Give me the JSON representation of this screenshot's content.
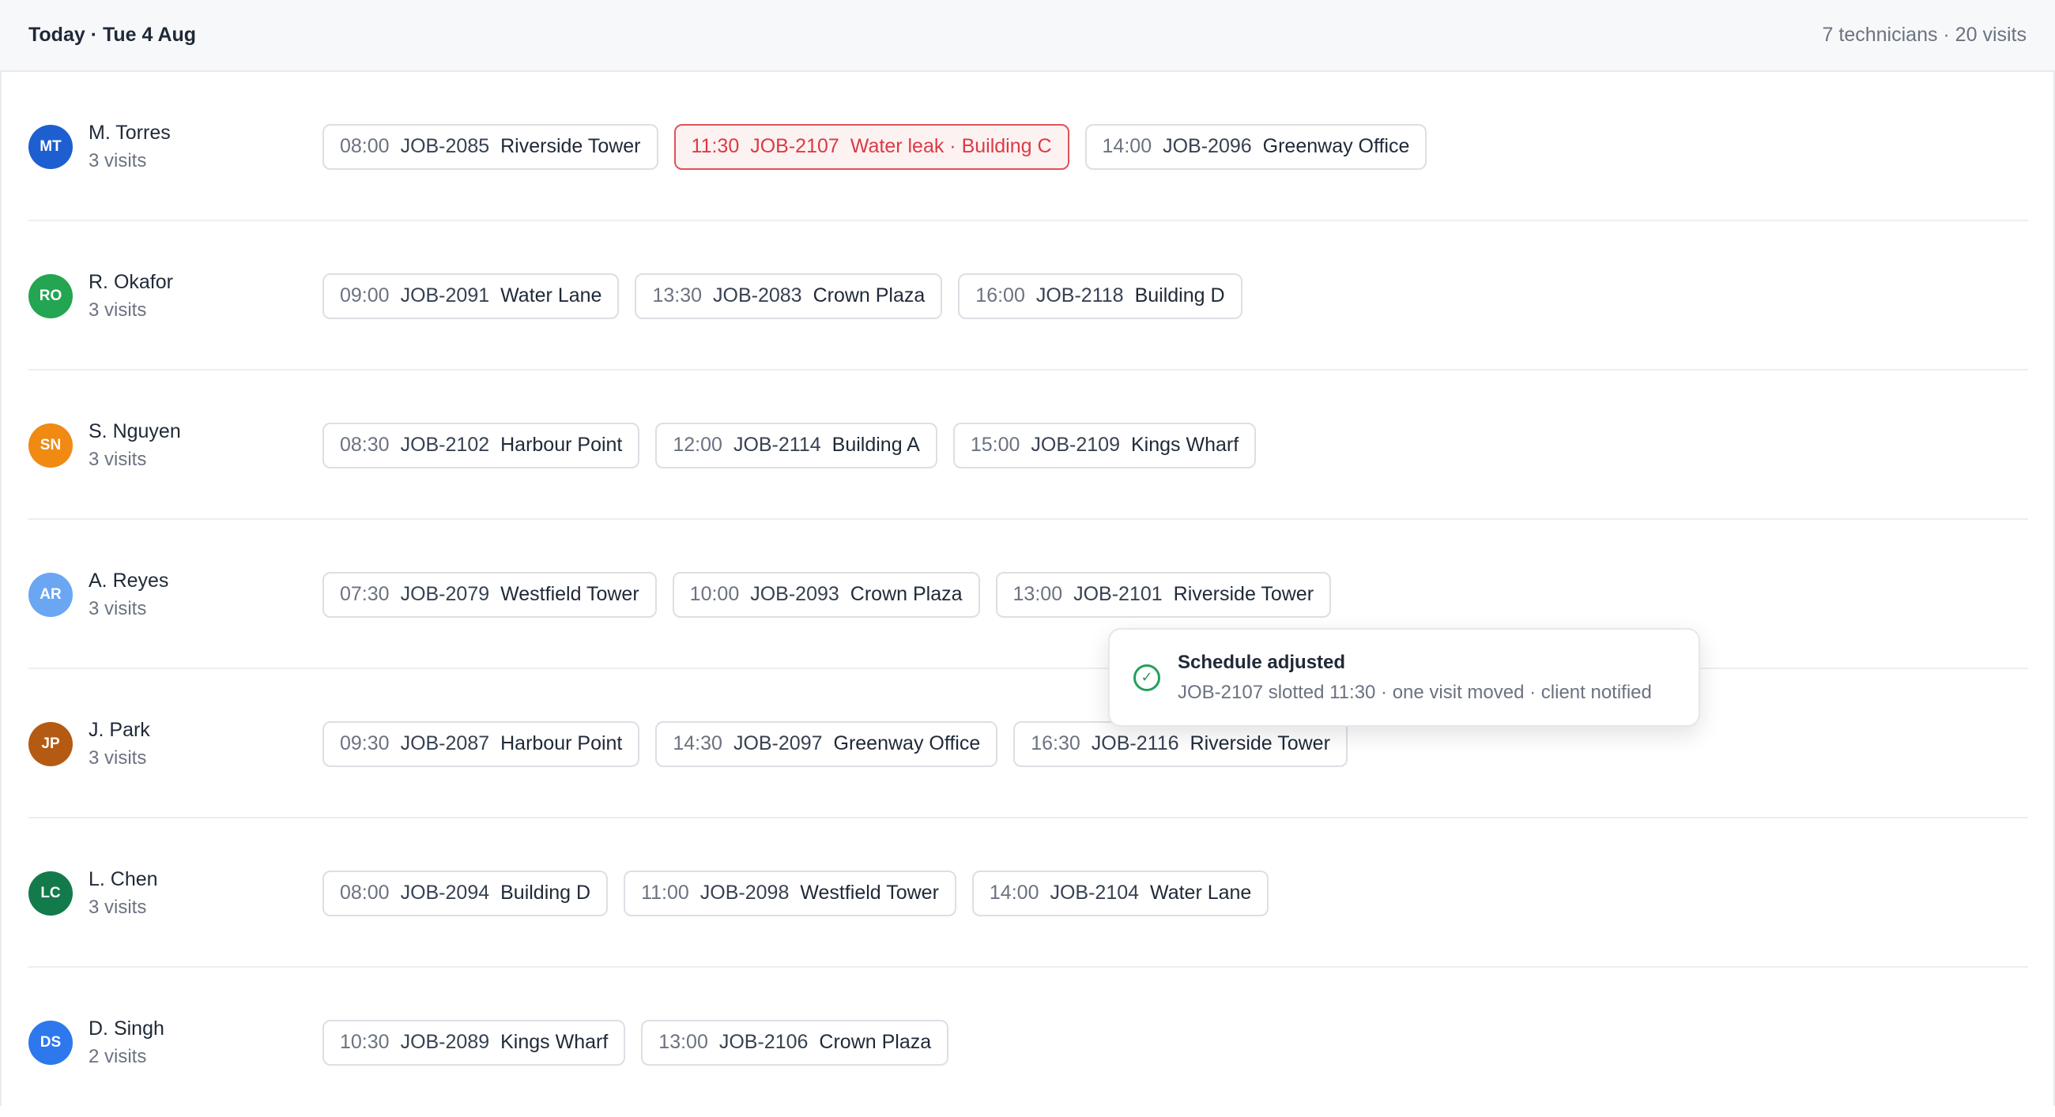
{
  "header": {
    "title": "Today · Tue 4 Aug",
    "meta": "7 technicians · 20 visits"
  },
  "technicians": [
    {
      "initials": "MT",
      "name": "M. Torres",
      "visits_label": "3 visits",
      "avatar_color": "#1d5fd0",
      "visits": [
        {
          "time": "08:00",
          "job": "JOB-2085",
          "site": "Riverside Tower"
        },
        {
          "time": "11:30",
          "job": "JOB-2107",
          "site": "Water leak · Building C",
          "status": "urgent"
        },
        {
          "time": "14:00",
          "job": "JOB-2096",
          "site": "Greenway Office"
        }
      ]
    },
    {
      "initials": "RO",
      "name": "R. Okafor",
      "visits_label": "3 visits",
      "avatar_color": "#23a552",
      "visits": [
        {
          "time": "09:00",
          "job": "JOB-2091",
          "site": "Water Lane"
        },
        {
          "time": "13:30",
          "job": "JOB-2083",
          "site": "Crown Plaza"
        },
        {
          "time": "16:00",
          "job": "JOB-2118",
          "site": "Building D"
        }
      ]
    },
    {
      "initials": "SN",
      "name": "S. Nguyen",
      "visits_label": "3 visits",
      "avatar_color": "#f08a13",
      "visits": [
        {
          "time": "08:30",
          "job": "JOB-2102",
          "site": "Harbour Point"
        },
        {
          "time": "12:00",
          "job": "JOB-2114",
          "site": "Building A"
        },
        {
          "time": "15:00",
          "job": "JOB-2109",
          "site": "Kings Wharf"
        }
      ]
    },
    {
      "initials": "AR",
      "name": "A. Reyes",
      "visits_label": "3 visits",
      "avatar_color": "#6aa6f2",
      "visits": [
        {
          "time": "07:30",
          "job": "JOB-2079",
          "site": "Westfield Tower"
        },
        {
          "time": "10:00",
          "job": "JOB-2093",
          "site": "Crown Plaza"
        },
        {
          "time": "13:00",
          "job": "JOB-2101",
          "site": "Riverside Tower"
        }
      ]
    },
    {
      "initials": "JP",
      "name": "J. Park",
      "visits_label": "3 visits",
      "avatar_color": "#b55a12",
      "visits": [
        {
          "time": "09:30",
          "job": "JOB-2087",
          "site": "Harbour Point"
        },
        {
          "time": "14:30",
          "job": "JOB-2097",
          "site": "Greenway Office"
        },
        {
          "time": "16:30",
          "job": "JOB-2116",
          "site": "Riverside Tower"
        }
      ]
    },
    {
      "initials": "LC",
      "name": "L. Chen",
      "visits_label": "3 visits",
      "avatar_color": "#137a4c",
      "visits": [
        {
          "time": "08:00",
          "job": "JOB-2094",
          "site": "Building D"
        },
        {
          "time": "11:00",
          "job": "JOB-2098",
          "site": "Westfield Tower"
        },
        {
          "time": "14:00",
          "job": "JOB-2104",
          "site": "Water Lane"
        }
      ]
    },
    {
      "initials": "DS",
      "name": "D. Singh",
      "visits_label": "2 visits",
      "avatar_color": "#2d78ec",
      "visits": [
        {
          "time": "10:30",
          "job": "JOB-2089",
          "site": "Kings Wharf"
        },
        {
          "time": "13:00",
          "job": "JOB-2106",
          "site": "Crown Plaza"
        }
      ]
    }
  ],
  "toast": {
    "icon": "check-circle-icon",
    "title": "Schedule adjusted",
    "message": "JOB-2107 slotted 11:30 · one visit moved · client notified",
    "color": "#22a05b"
  }
}
